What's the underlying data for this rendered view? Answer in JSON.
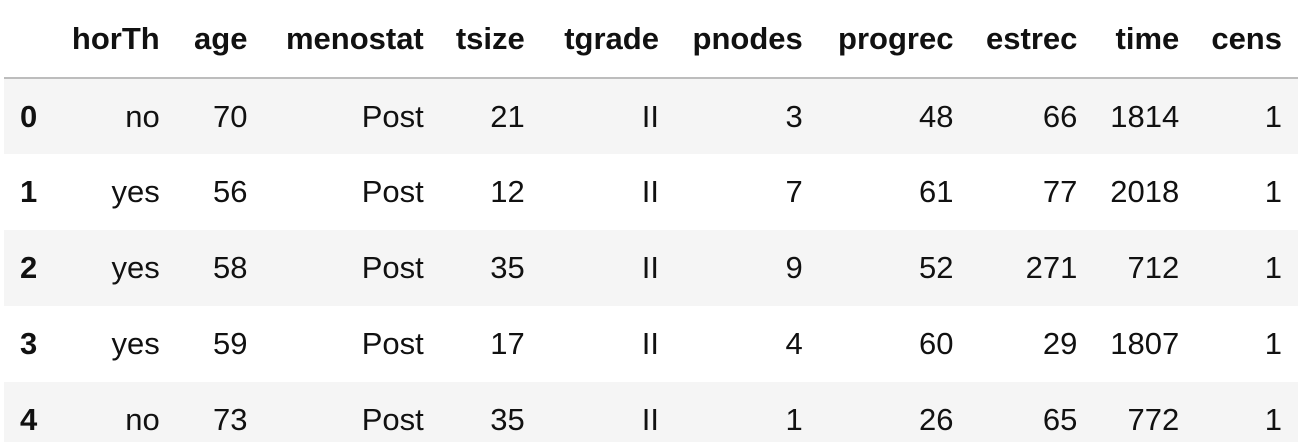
{
  "table": {
    "index_header": "",
    "columns": [
      "horTh",
      "age",
      "menostat",
      "tsize",
      "tgrade",
      "pnodes",
      "progrec",
      "estrec",
      "time",
      "cens"
    ],
    "rows": [
      {
        "index": "0",
        "cells": [
          "no",
          "70",
          "Post",
          "21",
          "II",
          "3",
          "48",
          "66",
          "1814",
          "1"
        ]
      },
      {
        "index": "1",
        "cells": [
          "yes",
          "56",
          "Post",
          "12",
          "II",
          "7",
          "61",
          "77",
          "2018",
          "1"
        ]
      },
      {
        "index": "2",
        "cells": [
          "yes",
          "58",
          "Post",
          "35",
          "II",
          "9",
          "52",
          "271",
          "712",
          "1"
        ]
      },
      {
        "index": "3",
        "cells": [
          "yes",
          "59",
          "Post",
          "17",
          "II",
          "4",
          "60",
          "29",
          "1807",
          "1"
        ]
      },
      {
        "index": "4",
        "cells": [
          "no",
          "73",
          "Post",
          "35",
          "II",
          "1",
          "26",
          "65",
          "772",
          "1"
        ]
      }
    ]
  },
  "colors": {
    "striped_row": "#f5f5f5",
    "header_rule": "#bdbdbd",
    "text": "#111111"
  }
}
